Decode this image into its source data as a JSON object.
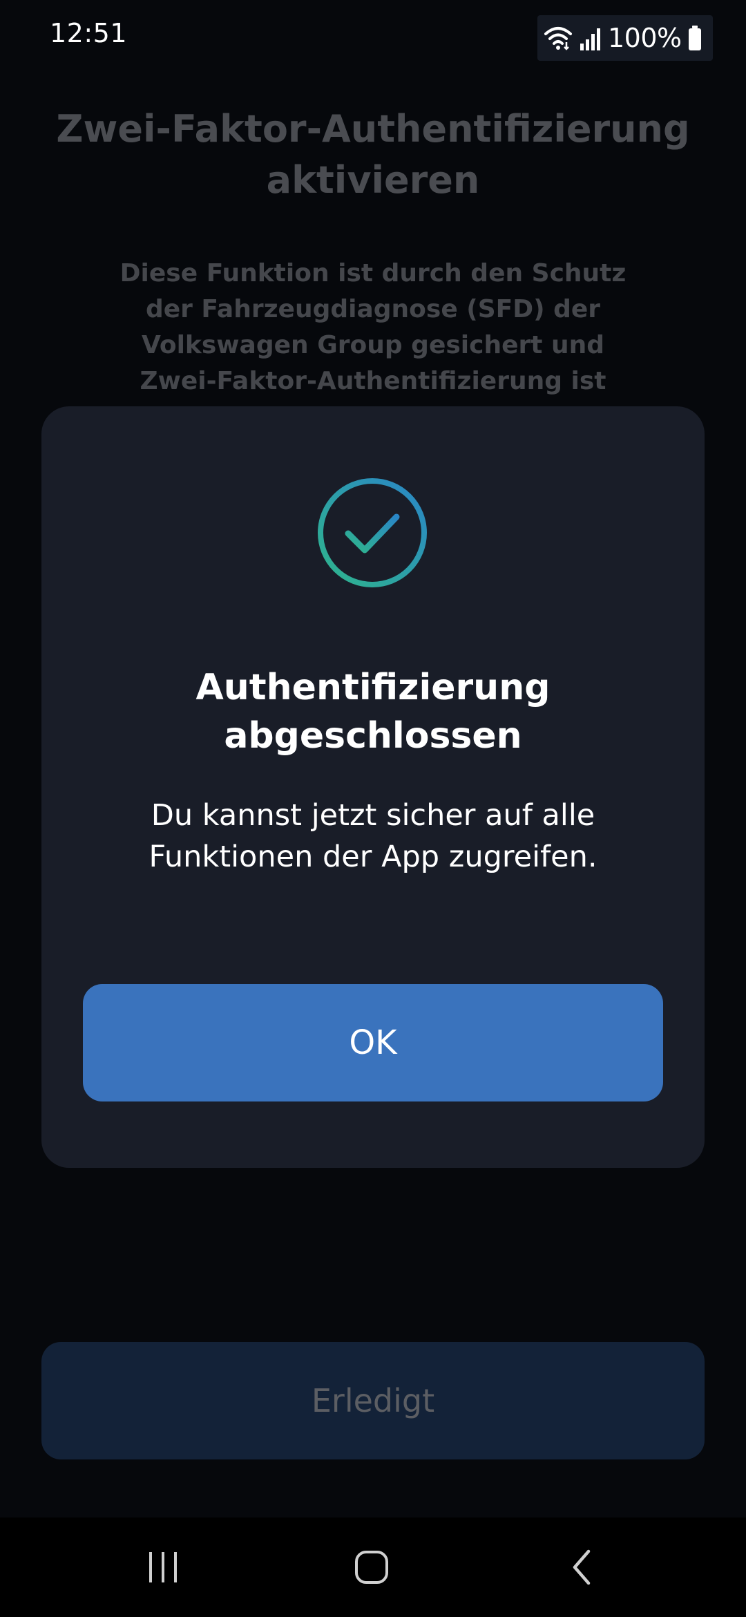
{
  "status_bar": {
    "time": "12:51",
    "battery": "100%",
    "icons": [
      "wifi-icon",
      "signal-icon",
      "battery-icon"
    ]
  },
  "background": {
    "title_line1": "Zwei-Faktor-Authentifizierung",
    "title_line2": "aktivieren",
    "description_lines": [
      "Diese Funktion ist durch den Schutz",
      "der Fahrzeugdiagnose (SFD) der",
      "Volkswagen Group gesichert und",
      "Zwei-Faktor-Authentifizierung ist"
    ],
    "done_label": "Erledigt"
  },
  "dialog": {
    "icon": "check-circle-icon",
    "title_line1": "Authentifizierung",
    "title_line2": "abgeschlossen",
    "message_line1": "Du kannst jetzt sicher auf alle",
    "message_line2": "Funktionen der App zugreifen.",
    "ok_label": "OK"
  },
  "nav_bar": {
    "buttons": [
      "recent-apps-icon",
      "home-icon",
      "back-icon"
    ]
  },
  "colors": {
    "background": "#06080c",
    "dialog": "#191d28",
    "ok_button": "#3a73bd",
    "done_button": "#132238",
    "check_gradient_start": "#2fb58c",
    "check_gradient_end": "#2a86c7"
  }
}
